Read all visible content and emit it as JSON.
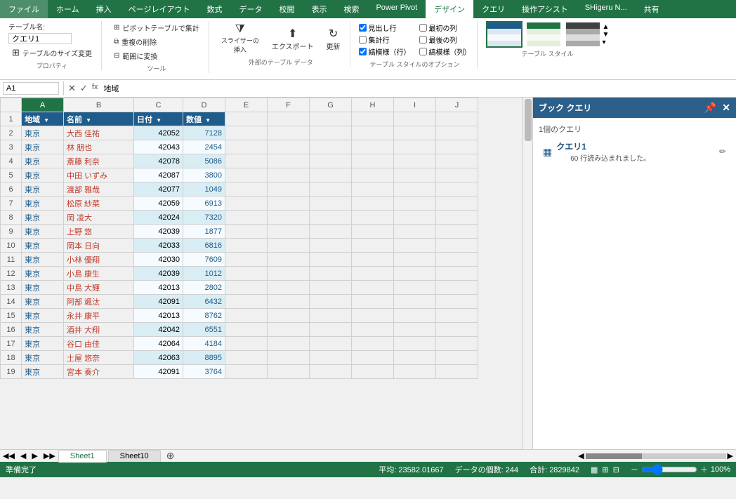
{
  "ribbon": {
    "tabs": [
      "ファイル",
      "ホーム",
      "挿入",
      "ページレイアウト",
      "数式",
      "データ",
      "校閲",
      "表示",
      "検索",
      "Power Pivot",
      "デザイン",
      "クエリ",
      "操作アシスト",
      "SHigeru N...",
      "共有"
    ],
    "active_tab": "デザイン",
    "groups": {
      "properties": {
        "label": "プロパティ",
        "table_name_label": "テーブル名:",
        "table_name_value": "クエリ1",
        "resize_label": "テーブルのサイズ変更"
      },
      "tools": {
        "label": "ツール",
        "btn1": "ピボットテーブルで集計",
        "btn2": "重複の削除",
        "btn3": "範囲に変換"
      },
      "external": {
        "label": "外部のテーブル データ",
        "slicer": "スライサーの\n挿入",
        "export": "エクスポート",
        "update": "更新"
      },
      "style_options": {
        "label": "テーブル スタイルのオプション",
        "header_row": "見出し行",
        "total_row": "集計行",
        "banded_rows": "縞模様（行）",
        "first_col": "最初の列",
        "last_col": "最後の列",
        "banded_cols": "縞模様（列）"
      },
      "table_style": {
        "label": "テーブル スタイル"
      }
    }
  },
  "formula_bar": {
    "name_box": "A1",
    "formula": "地域"
  },
  "columns": [
    "",
    "A",
    "B",
    "C",
    "D",
    "E",
    "F",
    "G",
    "H",
    "I",
    "J"
  ],
  "headers": [
    "地域",
    "名前",
    "日付",
    "数値"
  ],
  "rows": [
    {
      "row": 2,
      "a": "東京",
      "b": "大西 佳祐",
      "c": "42052",
      "d": "7128"
    },
    {
      "row": 3,
      "a": "東京",
      "b": "林 朋也",
      "c": "42043",
      "d": "2454"
    },
    {
      "row": 4,
      "a": "東京",
      "b": "斎藤 利奈",
      "c": "42078",
      "d": "5086"
    },
    {
      "row": 5,
      "a": "東京",
      "b": "中田 いずみ",
      "c": "42087",
      "d": "3800"
    },
    {
      "row": 6,
      "a": "東京",
      "b": "渡部 雅哉",
      "c": "42077",
      "d": "1049"
    },
    {
      "row": 7,
      "a": "東京",
      "b": "松原 紗菜",
      "c": "42059",
      "d": "6913"
    },
    {
      "row": 8,
      "a": "東京",
      "b": "岡 凌大",
      "c": "42024",
      "d": "7320"
    },
    {
      "row": 9,
      "a": "東京",
      "b": "上野 悠",
      "c": "42039",
      "d": "1877"
    },
    {
      "row": 10,
      "a": "東京",
      "b": "岡本 日向",
      "c": "42033",
      "d": "6816"
    },
    {
      "row": 11,
      "a": "東京",
      "b": "小林 優翔",
      "c": "42030",
      "d": "7609"
    },
    {
      "row": 12,
      "a": "東京",
      "b": "小島 康生",
      "c": "42039",
      "d": "1012"
    },
    {
      "row": 13,
      "a": "東京",
      "b": "中島 大輝",
      "c": "42013",
      "d": "2802"
    },
    {
      "row": 14,
      "a": "東京",
      "b": "阿部 颯汰",
      "c": "42091",
      "d": "6432"
    },
    {
      "row": 15,
      "a": "東京",
      "b": "永井 康平",
      "c": "42013",
      "d": "8762"
    },
    {
      "row": 16,
      "a": "東京",
      "b": "酒井 大翔",
      "c": "42042",
      "d": "6551"
    },
    {
      "row": 17,
      "a": "東京",
      "b": "谷口 由佳",
      "c": "42064",
      "d": "4184"
    },
    {
      "row": 18,
      "a": "東京",
      "b": "土屋 悠奈",
      "c": "42063",
      "d": "8895"
    },
    {
      "row": 19,
      "a": "東京",
      "b": "宮本 奏介",
      "c": "42091",
      "d": "3764"
    }
  ],
  "sheet_tabs": [
    "Sheet1",
    "Sheet10"
  ],
  "active_sheet": "Sheet1",
  "status_bar": {
    "status": "準備完了",
    "avg": "平均: 23582.01667",
    "count": "データの個数: 244",
    "sum": "合計: 2829842",
    "zoom": "100%"
  },
  "query_pane": {
    "title": "ブック クエリ",
    "count_label": "1個のクエリ",
    "query_name": "クエリ1",
    "query_rows": "60 行読み込まれました。"
  }
}
